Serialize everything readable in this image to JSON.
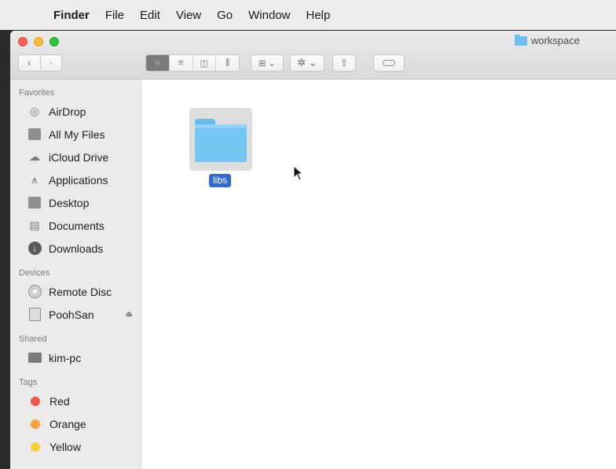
{
  "menubar": {
    "apple": "",
    "items": [
      "Finder",
      "File",
      "Edit",
      "View",
      "Go",
      "Window",
      "Help"
    ]
  },
  "window": {
    "title": "workspace"
  },
  "toolbar": {
    "back": "‹",
    "forward": "›",
    "view_icons": "⁘",
    "view_list": "≡",
    "view_columns": "◫",
    "view_coverflow": "⫼",
    "arrange": "⊞ ⌄",
    "action": "✲ ⌄",
    "share": "⇪"
  },
  "sidebar": {
    "favorites_title": "Favorites",
    "favorites": [
      "AirDrop",
      "All My Files",
      "iCloud Drive",
      "Applications",
      "Desktop",
      "Documents",
      "Downloads"
    ],
    "devices_title": "Devices",
    "devices": [
      "Remote Disc",
      "PoohSan"
    ],
    "shared_title": "Shared",
    "shared": [
      "kim-pc"
    ],
    "tags_title": "Tags",
    "tags": [
      {
        "label": "Red",
        "color": "#f0544f"
      },
      {
        "label": "Orange",
        "color": "#f6a33d"
      },
      {
        "label": "Yellow",
        "color": "#f5cf3c"
      }
    ]
  },
  "content": {
    "files": [
      {
        "name": "libs",
        "icon": "folder-icon",
        "selected": true
      }
    ]
  }
}
